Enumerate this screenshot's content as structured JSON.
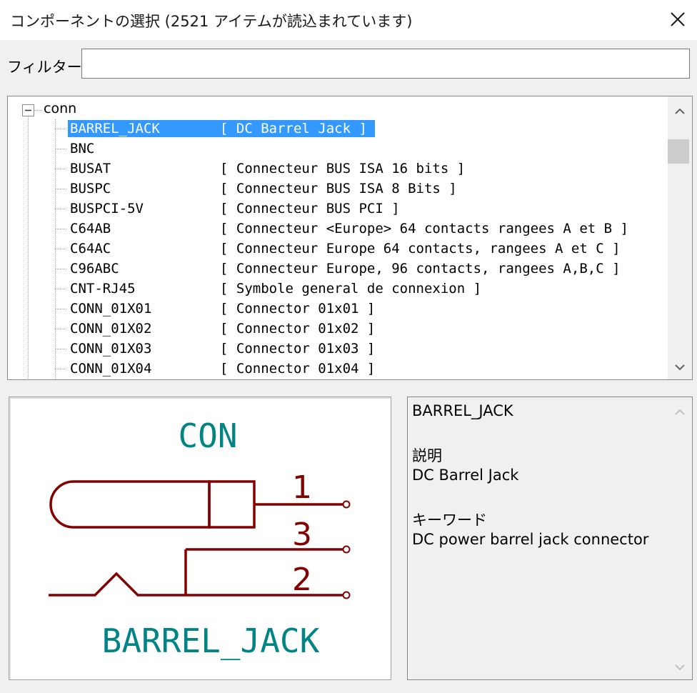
{
  "window": {
    "title": "コンポーネントの選択 (2521 アイテムが読込まれています)",
    "close_icon": "close-icon"
  },
  "filter": {
    "label": "フィルター:",
    "value": "",
    "placeholder": ""
  },
  "tree": {
    "root": "conn",
    "items": [
      {
        "name": "BARREL_JACK",
        "desc": "[ DC Barrel Jack ]",
        "selected": true
      },
      {
        "name": "BNC",
        "desc": ""
      },
      {
        "name": "BUSAT",
        "desc": "[ Connecteur BUS ISA 16 bits ]"
      },
      {
        "name": "BUSPC",
        "desc": "[ Connecteur BUS ISA 8 Bits ]"
      },
      {
        "name": "BUSPCI-5V",
        "desc": "[ Connecteur BUS PCI ]"
      },
      {
        "name": "C64AB",
        "desc": "[ Connecteur <Europe> 64 contacts rangees A et B ]"
      },
      {
        "name": "C64AC",
        "desc": "[ Connecteur Europe 64 contacts, rangees A et C ]"
      },
      {
        "name": "C96ABC",
        "desc": "[ Connecteur Europe, 96 contacts, rangees A,B,C ]"
      },
      {
        "name": "CNT-RJ45",
        "desc": "[ Symbole general de connexion ]"
      },
      {
        "name": "CONN_01X01",
        "desc": "[ Connector 01x01 ]"
      },
      {
        "name": "CONN_01X02",
        "desc": "[ Connector 01x02 ]"
      },
      {
        "name": "CONN_01X03",
        "desc": "[ Connector 01x03 ]"
      },
      {
        "name": "CONN_01X04",
        "desc": "[ Connector 01x04 ]"
      }
    ]
  },
  "preview": {
    "reference": "CON",
    "value": "BARREL_JACK",
    "pins": [
      "1",
      "3",
      "2"
    ],
    "colors": {
      "line": "#840000",
      "text": "#008484"
    }
  },
  "details": {
    "name": "BARREL_JACK",
    "desc_label": "説明",
    "desc": "DC Barrel Jack",
    "keywords_label": "キーワード",
    "keywords": "DC power barrel jack connector"
  }
}
